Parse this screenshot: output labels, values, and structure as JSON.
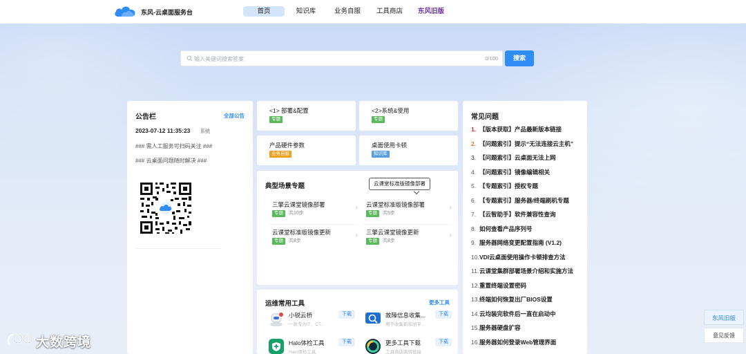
{
  "header": {
    "brand": "东风-云桌面服务台",
    "nav": [
      {
        "label": "首页",
        "active": true
      },
      {
        "label": "知识库"
      },
      {
        "label": "业务自服"
      },
      {
        "label": "工具商店"
      },
      {
        "label": "东风旧版"
      }
    ]
  },
  "search": {
    "placeholder": "输入关键词搜索答案",
    "count": "0/100",
    "button": "搜索"
  },
  "announcement": {
    "title": "公告栏",
    "all_link": "全部公告",
    "date": "2023-07-12 11:35:23",
    "source": "系统",
    "lines": [
      "### 需人工服务可扫码关注 ###",
      "### 云桌面问题随时解决 ###"
    ],
    "qr_icon": "qr-code"
  },
  "categories": [
    {
      "title": "<1> 部署&配置",
      "tag": "专题",
      "tag_color": "#5cb85c"
    },
    {
      "title": "<2>系统&使用",
      "tag": "专题",
      "tag_color": "#5cb85c"
    },
    {
      "title": "产品硬件参数",
      "tag": "业务自服",
      "tag_color": "#f0a020"
    },
    {
      "title": "桌面使用卡顿",
      "tag": "知识库",
      "tag_color": "#5c9fe0"
    }
  ],
  "scenarios": {
    "title": "典型场景专题",
    "tooltip": "云课堂标准版镜像部署",
    "items": [
      {
        "title": "三擎云课堂镜像部署",
        "tag": "专题",
        "steps": "共10步"
      },
      {
        "title": "云课堂标准版镜像部署",
        "tag": "专题",
        "steps": "共5步"
      },
      {
        "title": "云课堂标准版镜像更新",
        "tag": "专题",
        "steps": "共8步"
      },
      {
        "title": "三擎云课堂镜像更新",
        "tag": "专题",
        "steps": "共8步"
      }
    ]
  },
  "tools": {
    "title": "运维常用工具",
    "more": "更多工具",
    "items": [
      {
        "name": "小锐云桥",
        "desc": "一款专为IT、CT...",
        "download": "下载",
        "icon": "robot-icon"
      },
      {
        "name": "故障信息收集...",
        "desc": "用于收集新和旧平...",
        "download": "下载",
        "icon": "diagnostic-icon"
      },
      {
        "name": "Halo体检工具",
        "desc": "Halo体检工具",
        "download": "下载",
        "icon": "health-check-icon"
      },
      {
        "name": "更多工具下载",
        "desc": "工具商店跳转链接",
        "download": "下载",
        "icon": "ring-icon"
      }
    ]
  },
  "faq": {
    "title": "常见问题",
    "items": [
      {
        "num": "1.",
        "text": "【版本获取】产品最新版本链接"
      },
      {
        "num": "2.",
        "text": "【问题索引】提示“无法连接云主机”"
      },
      {
        "num": "3.",
        "text": "【问题索引】云桌面无法上网"
      },
      {
        "num": "4.",
        "text": "【问题索引】镜像编辑相关"
      },
      {
        "num": "5.",
        "text": "【专题索引】授权专题"
      },
      {
        "num": "6.",
        "text": "【专题索引】服务器/终端刷机专题"
      },
      {
        "num": "7.",
        "text": "【云智助手】软件兼容性查询"
      },
      {
        "num": "8.",
        "text": "如何查看产品序列号"
      },
      {
        "num": "9.",
        "text": "服务器网络变更配置指南 (V1.2)"
      },
      {
        "num": "10.",
        "text": "VDI云桌面使用操作卡顿排查方法"
      },
      {
        "num": "11.",
        "text": "云课堂集群部署场景介绍和实施方法"
      },
      {
        "num": "12.",
        "text": "重置终端设置密码"
      },
      {
        "num": "13.",
        "text": "终端如何恢复出厂BIOS设置"
      },
      {
        "num": "14.",
        "text": "云均装完软件后一直在启动中"
      },
      {
        "num": "15.",
        "text": "服务器硬盘扩容"
      },
      {
        "num": "16.",
        "text": "服务器如何登录Web管理界面"
      }
    ]
  },
  "floating": {
    "old_version": "东风旧版",
    "feedback": "意见反馈"
  },
  "watermark": "大数跨境",
  "colors": {
    "accent": "#2f8cf4",
    "tag_green": "#5cb85c",
    "tag_orange": "#f0a020",
    "tag_blue": "#5c9fe0",
    "nav_purple": "#6a2fa3"
  }
}
